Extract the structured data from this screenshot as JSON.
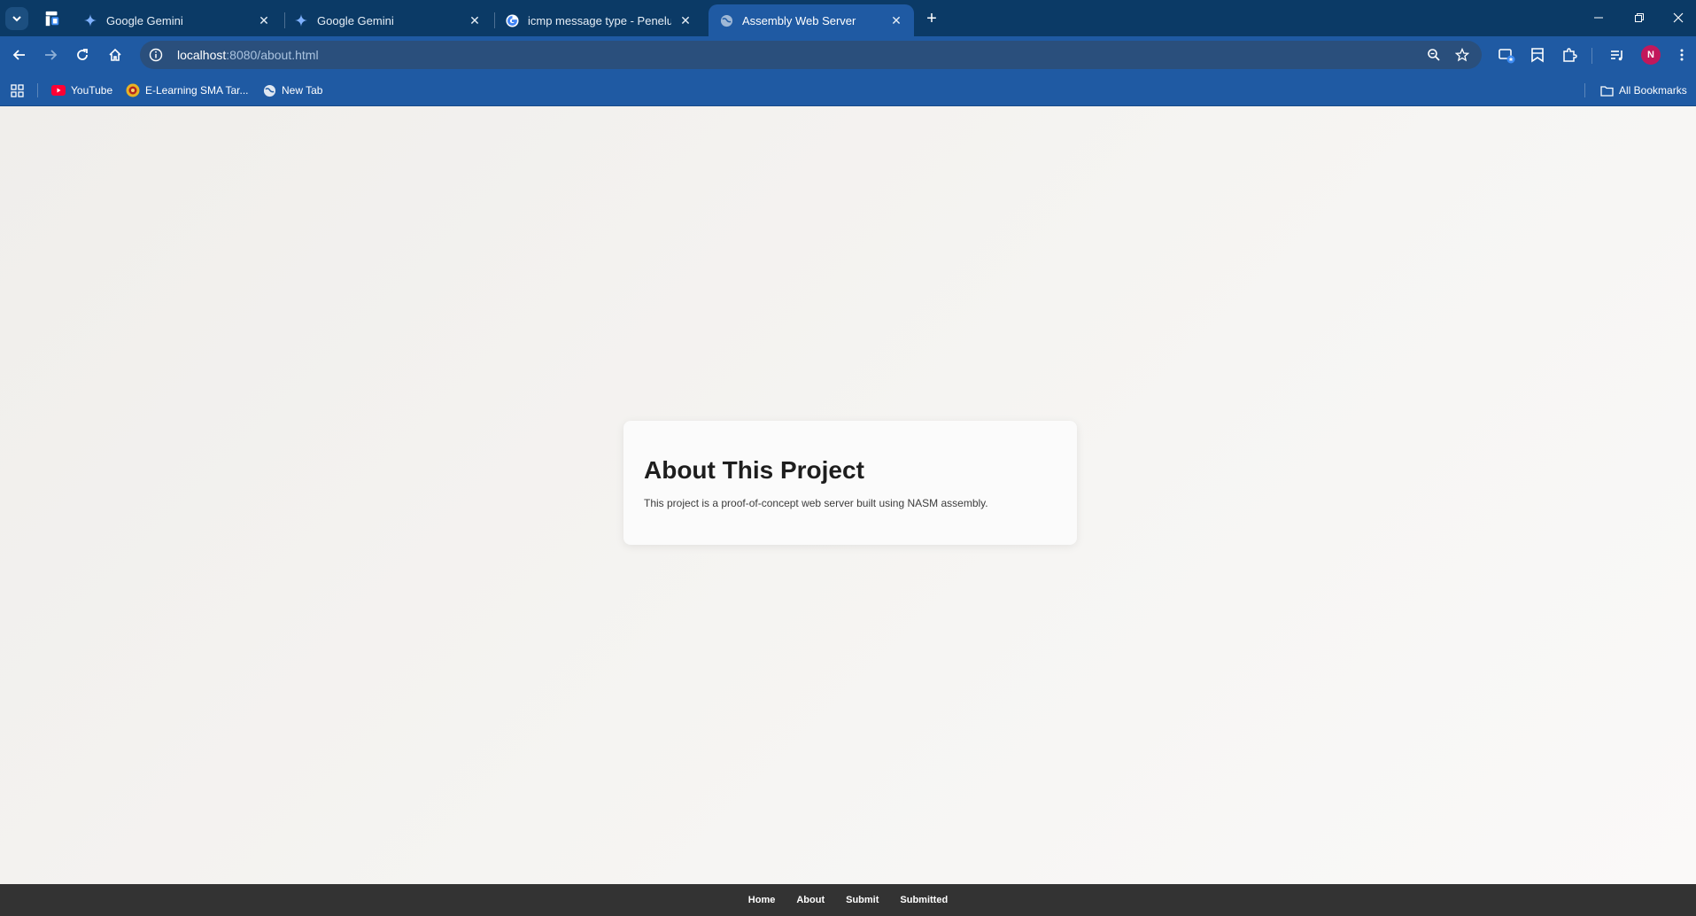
{
  "browser": {
    "tabs": [
      {
        "title": "Google Gemini",
        "favicon": "gemini-icon",
        "active": false
      },
      {
        "title": "Google Gemini",
        "favicon": "gemini-icon",
        "active": false
      },
      {
        "title": "icmp message type - Penelusuran",
        "favicon": "google-icon",
        "active": false
      },
      {
        "title": "Assembly Web Server",
        "favicon": "globe-icon",
        "active": true
      }
    ],
    "address": {
      "host": "localhost",
      "path": ":8080/about.html"
    },
    "bookmarks": [
      {
        "label": "YouTube",
        "icon": "youtube-icon"
      },
      {
        "label": "E-Learning SMA Tar...",
        "icon": "school-logo-icon"
      },
      {
        "label": "New Tab",
        "icon": "globe-icon"
      }
    ],
    "all_bookmarks_label": "All Bookmarks",
    "profile_initial": "N",
    "colors": {
      "frame": "#0b3a66",
      "toolbar": "#1f5aa3",
      "avatar": "#c2185b"
    }
  },
  "page": {
    "heading": "About This Project",
    "description": "This project is a proof-of-concept web server built using NASM assembly.",
    "footer_nav": [
      "Home",
      "About",
      "Submit",
      "Submitted"
    ],
    "colors": {
      "footer": "#333333",
      "card": "#fbfbfb"
    }
  }
}
